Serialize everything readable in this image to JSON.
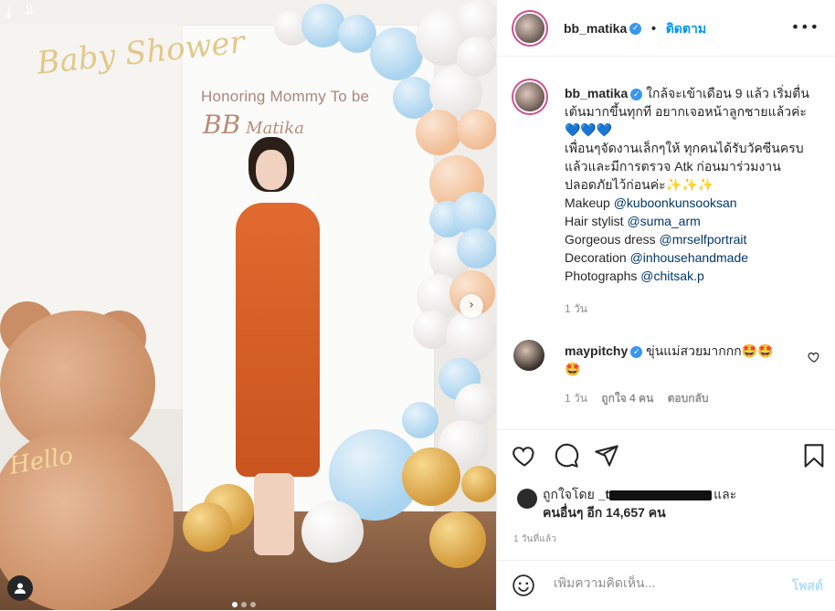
{
  "post": {
    "username": "bb_matika",
    "follow_label": "ติดตาม",
    "more_icon": "•••"
  },
  "photo": {
    "backdrop_script": "Baby Shower",
    "backdrop_title": "Honoring Mommy To be",
    "backdrop_name_bb": "BB",
    "backdrop_name": "Matika",
    "bear_tag": "Hello",
    "current_slide": 1,
    "total_slides": 3
  },
  "caption": {
    "username": "bb_matika",
    "lines": [
      "ใกล้จะเข้าเดือน 9 แล้ว เริ่มตื่น",
      "เต้นมากขึ้นทุกที อยากเจอหน้าลูกชายแล้วค่ะ",
      "💙💙💙",
      "เพื่อนๆจัดงานเล็กๆให้ ทุกคนได้รับวัคซีนครบ",
      "แล้วและมีการตรวจ Atk ก่อนมาร่วมงาน",
      "ปลอดภัยไว้ก่อนค่ะ✨✨✨"
    ],
    "credits": [
      {
        "label": "Makeup",
        "handle": "@kuboonkunsooksan"
      },
      {
        "label": "Hair stylist",
        "handle": "@suma_arm"
      },
      {
        "label": "Gorgeous dress",
        "handle": "@mrselfportrait"
      },
      {
        "label": "Decoration",
        "handle": "@inhousehandmade"
      },
      {
        "label": "Photographs",
        "handle": "@chitsak.p"
      }
    ],
    "time": "1 วัน"
  },
  "comment": {
    "username": "maypitchy",
    "text": "ขุ่นแม่สวยมากกก🤩🤩",
    "text_line2": "🤩",
    "time": "1 วัน",
    "likes": "ถูกใจ 4 คน",
    "reply": "ตอบกลับ"
  },
  "likes": {
    "prefix": "ถูกใจโดย",
    "name_partial": "_t",
    "and": "และ",
    "others": "คนอื่นๆ อีก 14,657 คน"
  },
  "post_time": "1 วันที่แล้ว",
  "add_comment": {
    "placeholder": "เพิ่มความคิดเห็น...",
    "post_label": "โพสต์"
  },
  "colors": {
    "accent": "#0095f6",
    "verified": "#3897f0",
    "dress": "#d85f26"
  }
}
